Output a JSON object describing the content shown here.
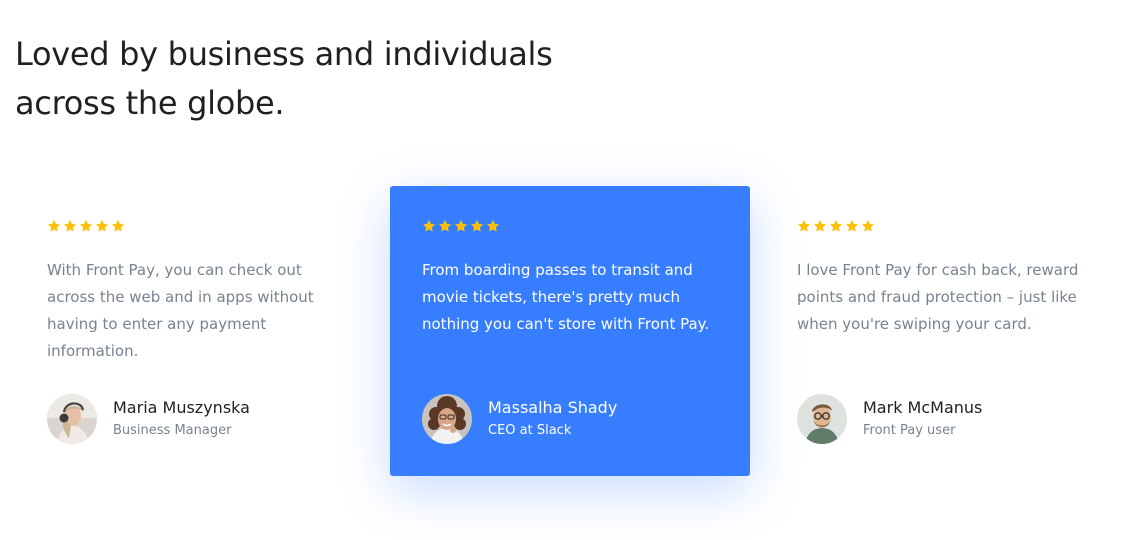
{
  "section": {
    "heading_line1": "Loved by business and individuals",
    "heading_line2": "across the globe."
  },
  "colors": {
    "accent": "#377dff",
    "star": "#ffc107",
    "heading": "#1e2022",
    "muted": "#77838f"
  },
  "testimonials": [
    {
      "rating": 5,
      "quote": "With Front Pay, you can check out across the web and in apps without having to enter any payment information.",
      "name": "Maria Muszynska",
      "role": "Business Manager",
      "avatar_icon": "avatar-woman-headphones"
    },
    {
      "rating": 5,
      "quote": "From boarding passes to transit and movie tickets, there's pretty much nothing you can't store with Front Pay.",
      "name": "Massalha Shady",
      "role": "CEO at Slack",
      "avatar_icon": "avatar-woman-curly-hair"
    },
    {
      "rating": 5,
      "quote": "I love Front Pay for cash back, reward points and fraud protection – just like when you're swiping your card.",
      "name": "Mark McManus",
      "role": "Front Pay user",
      "avatar_icon": "avatar-man-glasses"
    }
  ]
}
